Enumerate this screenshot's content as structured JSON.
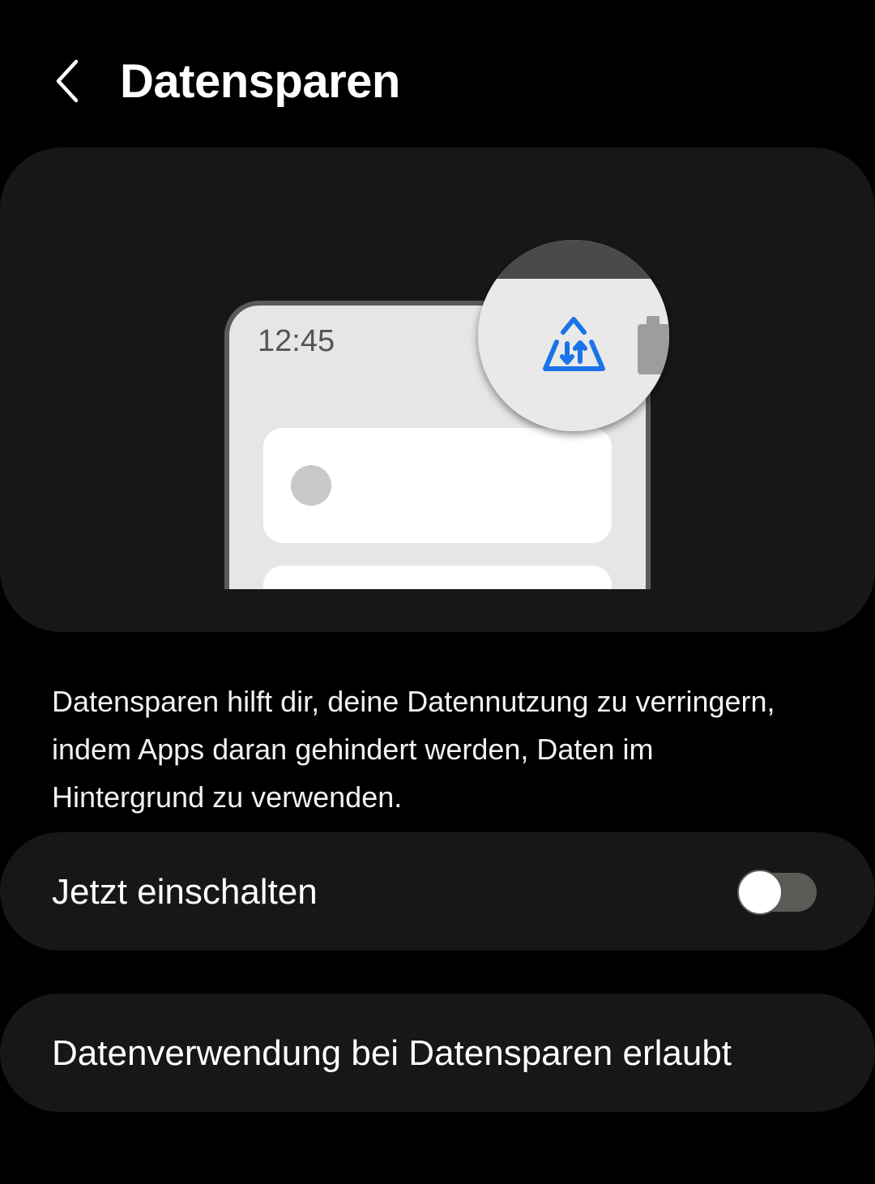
{
  "header": {
    "back_icon": "chevron-left-icon",
    "title": "Datensparen"
  },
  "illustration": {
    "clock": "12:45",
    "data_saver_icon": "data-saver-triangle-icon",
    "battery_icon": "battery-icon",
    "accent_color": "#1a73e8"
  },
  "description": "Datensparen hilft dir, deine Datennutzung zu verringern, indem Apps daran gehindert werden, Daten im Hintergrund zu verwenden.",
  "toggle": {
    "label": "Jetzt einschalten",
    "state": "off"
  },
  "allowed": {
    "label": "Datenverwendung bei Datensparen erlaubt"
  },
  "colors": {
    "background": "#000000",
    "card": "#171717",
    "switch_track_off": "#5b5b58"
  }
}
